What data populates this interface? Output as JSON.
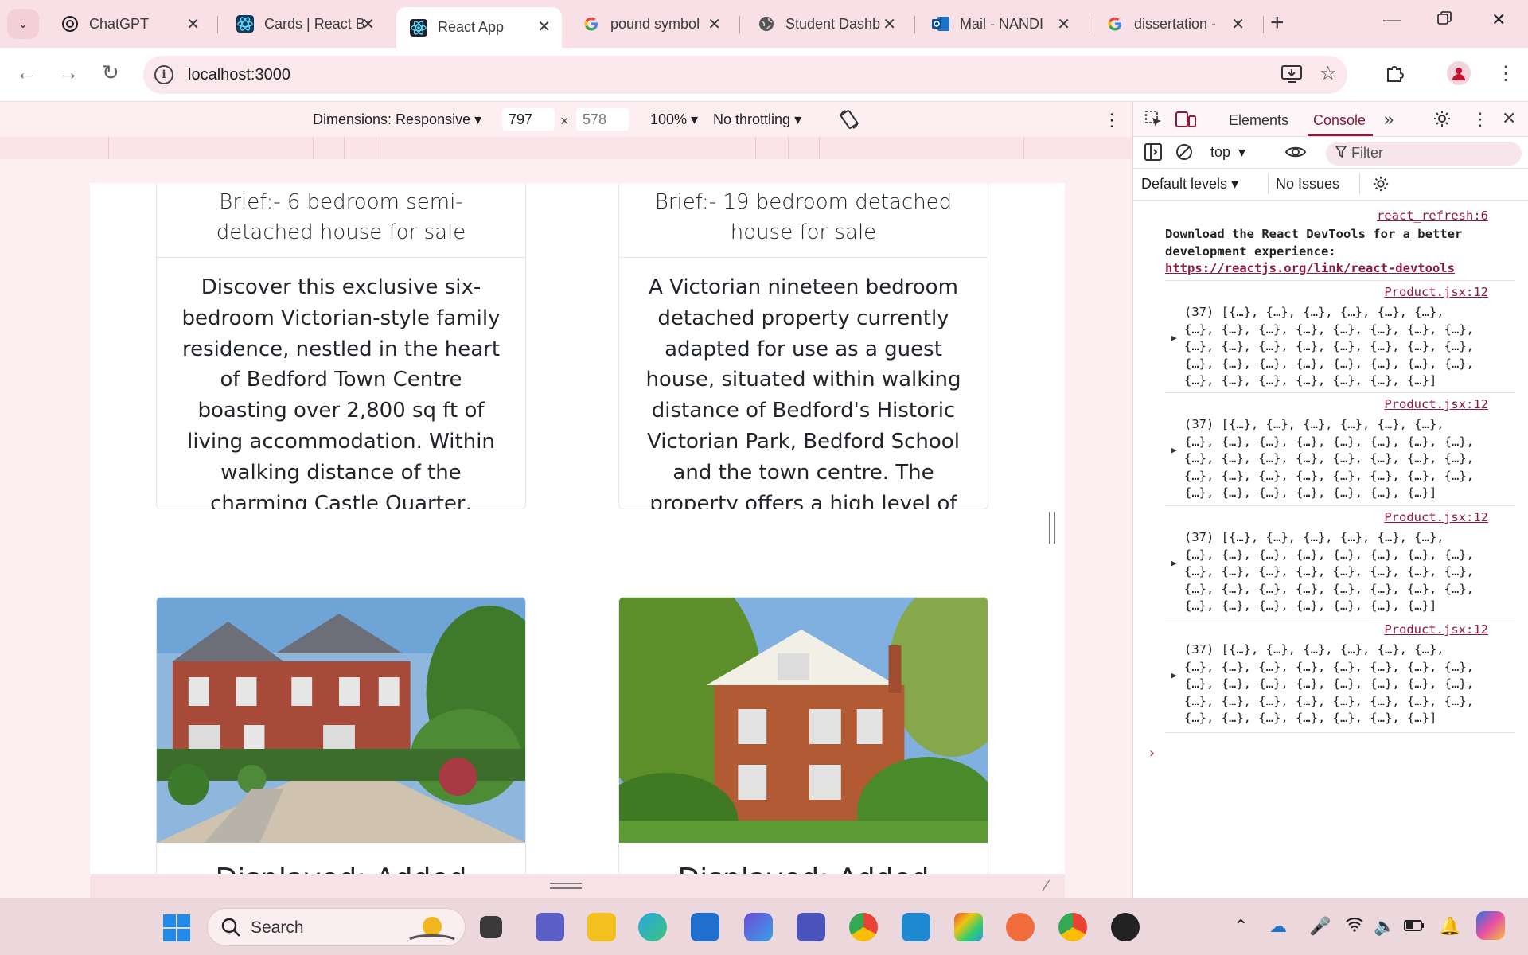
{
  "browser": {
    "tabs": [
      {
        "title": "ChatGPT",
        "icon": "chatgpt-icon"
      },
      {
        "title": "Cards | React B",
        "icon": "react-bootstrap-icon"
      },
      {
        "title": "React App",
        "icon": "react-icon",
        "active": true
      },
      {
        "title": "pound symbol",
        "icon": "google-icon"
      },
      {
        "title": "Student Dashb",
        "icon": "globe-icon"
      },
      {
        "title": "Mail - NANDI",
        "icon": "outlook-icon"
      },
      {
        "title": "dissertation -",
        "icon": "google-icon"
      }
    ],
    "url": "localhost:3000"
  },
  "device_toolbar": {
    "dimensions_label": "Dimensions: Responsive",
    "width": "797",
    "height": "578",
    "zoom": "100%",
    "throttling": "No throttling"
  },
  "page": {
    "cards_top": [
      {
        "brief": "Brief:- 6 bedroom semi-detached house for sale",
        "description": "Discover this exclusive six-bedroom Victorian-style family residence, nestled in the heart of Bedford Town Centre boasting over 2,800 sq ft of living accommodation. Within walking distance of the charming Castle Quarter, Russell Park, and The Embankment, this gated home built in 2005 offers an..."
      },
      {
        "brief": "Brief:- 19 bedroom detached house for sale",
        "description": "A Victorian nineteen bedroom detached property currently adapted for use as a guest house, situated within walking distance of Bedford's Historic Victorian Park, Bedford School and the town centre. The property offers a high level of versatility, with the potential to reconfigure the layout for a..."
      }
    ],
    "cards_bottom": [
      {
        "title": "Displayed: Added",
        "image": "red-brick-terrace-house-photo"
      },
      {
        "title": "Displayed: Added",
        "image": "victorian-detached-house-photo"
      }
    ]
  },
  "devtools": {
    "tabs": [
      "Elements",
      "Console"
    ],
    "active_tab": "Console",
    "context": "top",
    "filter_placeholder": "Filter",
    "levels": "Default levels",
    "issues": "No Issues",
    "messages": {
      "react_source": "react_refresh:6",
      "react_line1": "Download the React DevTools for a better",
      "react_line2": "development experience:",
      "react_link": "https://reactjs.org/link/react-devtools",
      "logs": [
        {
          "source": "Product.jsx:12",
          "line1": "(37) [{…}, {…}, {…}, {…}, {…}, {…},",
          "line2": "{…}, {…}, {…}, {…}, {…}, {…}, {…}, {…},",
          "line3": "{…}, {…}, {…}, {…}, {…}, {…}, {…}, {…},",
          "line4": "{…}, {…}, {…}, {…}, {…}, {…}, {…}, {…},",
          "line5": "{…}, {…}, {…}, {…}, {…}, {…}, {…}]"
        },
        {
          "source": "Product.jsx:12",
          "line1": "(37) [{…}, {…}, {…}, {…}, {…}, {…},",
          "line2": "{…}, {…}, {…}, {…}, {…}, {…}, {…}, {…},",
          "line3": "{…}, {…}, {…}, {…}, {…}, {…}, {…}, {…},",
          "line4": "{…}, {…}, {…}, {…}, {…}, {…}, {…}, {…},",
          "line5": "{…}, {…}, {…}, {…}, {…}, {…}, {…}]"
        },
        {
          "source": "Product.jsx:12",
          "line1": "(37) [{…}, {…}, {…}, {…}, {…}, {…},",
          "line2": "{…}, {…}, {…}, {…}, {…}, {…}, {…}, {…},",
          "line3": "{…}, {…}, {…}, {…}, {…}, {…}, {…}, {…},",
          "line4": "{…}, {…}, {…}, {…}, {…}, {…}, {…}, {…},",
          "line5": "{…}, {…}, {…}, {…}, {…}, {…}, {…}]"
        },
        {
          "source": "Product.jsx:12",
          "line1": "(37) [{…}, {…}, {…}, {…}, {…}, {…},",
          "line2": "{…}, {…}, {…}, {…}, {…}, {…}, {…}, {…},",
          "line3": "{…}, {…}, {…}, {…}, {…}, {…}, {…}, {…},",
          "line4": "{…}, {…}, {…}, {…}, {…}, {…}, {…}, {…},",
          "line5": "{…}, {…}, {…}, {…}, {…}, {…}, {…}]"
        }
      ]
    }
  },
  "taskbar": {
    "search_label": "Search"
  },
  "colors": {
    "accent": "#8b1a3a",
    "tabstrip": "#f9dfe6",
    "taskbar": "#ecd7dd"
  }
}
